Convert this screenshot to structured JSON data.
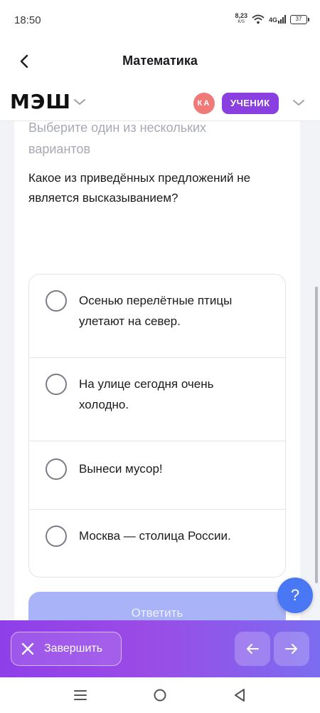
{
  "status_bar": {
    "time": "18:50",
    "net_speed_value": "8,23",
    "net_speed_unit": "K/S",
    "network_type": "4G",
    "battery": "37"
  },
  "header": {
    "title": "Математика"
  },
  "brand": {
    "logo_text": "МЭШ",
    "avatar_initials": "КА",
    "role_label": "УЧЕНИК"
  },
  "task": {
    "hint": "Выберите один из нескольких вариантов",
    "question": "Какое из приведённых предложений не является высказыванием?",
    "options": [
      {
        "label": "Осенью перелётные птицы улетают на север."
      },
      {
        "label": "На улице сегодня очень холодно."
      },
      {
        "label": "Вынеси мусор!"
      },
      {
        "label": "Москва — столица России."
      }
    ],
    "answer_label": "Ответить"
  },
  "help": {
    "label": "?"
  },
  "action_bar": {
    "finish_label": "Завершить"
  },
  "colors": {
    "accent_purple": "#8a3fe0",
    "answer_button": "#a9b3f7",
    "help_button": "#4a78f5",
    "avatar": "#f07a78"
  },
  "icons": {
    "back": "chevron-left-icon",
    "finish": "close-icon",
    "prev": "arrow-left-icon",
    "next": "arrow-right-icon",
    "menu": "menu-icon",
    "home": "home-icon",
    "back_system": "triangle-back-icon"
  }
}
